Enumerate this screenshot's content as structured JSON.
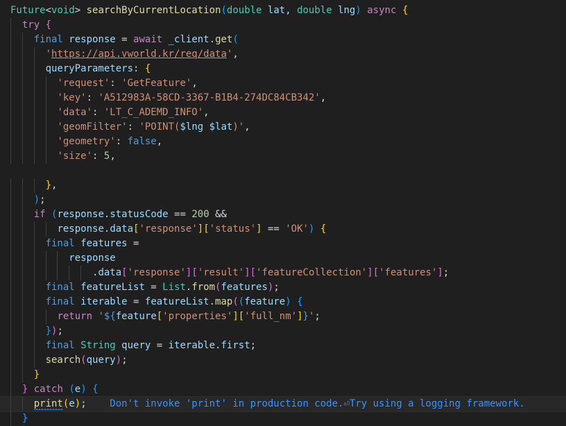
{
  "editor": {
    "lines": [
      {
        "indent": 0,
        "tokens": [
          [
            "Future",
            "type"
          ],
          [
            "<",
            "op"
          ],
          [
            "void",
            "type"
          ],
          [
            "> ",
            "op"
          ],
          [
            "searchByCurrentLocation",
            "fn"
          ],
          [
            "(",
            "p3"
          ],
          [
            "double",
            "type"
          ],
          [
            " lat, ",
            "var"
          ],
          [
            "double",
            "type"
          ],
          [
            " lng",
            "var"
          ],
          [
            ")",
            "p3"
          ],
          [
            " async ",
            "kw"
          ],
          [
            "{",
            "p1"
          ]
        ]
      },
      {
        "indent": 2,
        "tokens": [
          [
            "try ",
            "kw"
          ],
          [
            "{",
            "p2"
          ]
        ]
      },
      {
        "indent": 4,
        "tokens": [
          [
            "final ",
            "decl"
          ],
          [
            "response",
            "var"
          ],
          [
            " = ",
            "op"
          ],
          [
            "await ",
            "kw"
          ],
          [
            "_client",
            "var"
          ],
          [
            ".",
            "op"
          ],
          [
            "get",
            "fn"
          ],
          [
            "(",
            "p3"
          ]
        ]
      },
      {
        "indent": 6,
        "tokens": [
          [
            "'",
            "str"
          ],
          [
            "https://api.vworld.kr/req/data",
            "url"
          ],
          [
            "'",
            "str"
          ],
          [
            ",",
            "op"
          ]
        ]
      },
      {
        "indent": 6,
        "tokens": [
          [
            "queryParameters",
            "var"
          ],
          [
            ": ",
            "op"
          ],
          [
            "{",
            "p1"
          ]
        ]
      },
      {
        "indent": 8,
        "tokens": [
          [
            "'request'",
            "str"
          ],
          [
            ": ",
            "op"
          ],
          [
            "'GetFeature'",
            "str"
          ],
          [
            ",",
            "op"
          ]
        ]
      },
      {
        "indent": 8,
        "tokens": [
          [
            "'key'",
            "str"
          ],
          [
            ": ",
            "op"
          ],
          [
            "'A512983A-58CD-3367-B1B4-274DC84CB342'",
            "str"
          ],
          [
            ",",
            "op"
          ]
        ]
      },
      {
        "indent": 8,
        "tokens": [
          [
            "'data'",
            "str"
          ],
          [
            ": ",
            "op"
          ],
          [
            "'LT_C_ADEMD_INFO'",
            "str"
          ],
          [
            ",",
            "op"
          ]
        ]
      },
      {
        "indent": 8,
        "tokens": [
          [
            "'geomFilter'",
            "str"
          ],
          [
            ": ",
            "op"
          ],
          [
            "'POINT(",
            "str"
          ],
          [
            "$lng",
            "var"
          ],
          [
            " ",
            "str"
          ],
          [
            "$lat",
            "var"
          ],
          [
            ")'",
            "str"
          ],
          [
            ",",
            "op"
          ]
        ]
      },
      {
        "indent": 8,
        "tokens": [
          [
            "'geometry'",
            "str"
          ],
          [
            ": ",
            "op"
          ],
          [
            "false",
            "decl"
          ],
          [
            ",",
            "op"
          ]
        ]
      },
      {
        "indent": 8,
        "tokens": [
          [
            "'size'",
            "str"
          ],
          [
            ": ",
            "op"
          ],
          [
            "5",
            "num"
          ],
          [
            ",",
            "op"
          ]
        ]
      },
      {
        "indent": 0,
        "tokens": []
      },
      {
        "indent": 6,
        "tokens": [
          [
            "}",
            "p1"
          ],
          [
            ",",
            "op"
          ]
        ]
      },
      {
        "indent": 4,
        "tokens": [
          [
            ")",
            "p3"
          ],
          [
            ";",
            "op"
          ]
        ]
      },
      {
        "indent": 4,
        "tokens": [
          [
            "if ",
            "kw"
          ],
          [
            "(",
            "p3"
          ],
          [
            "response",
            "var"
          ],
          [
            ".",
            "op"
          ],
          [
            "statusCode",
            "var"
          ],
          [
            " == ",
            "op"
          ],
          [
            "200",
            "num"
          ],
          [
            " &&",
            "op"
          ]
        ]
      },
      {
        "indent": 8,
        "tokens": [
          [
            "response",
            "var"
          ],
          [
            ".",
            "op"
          ],
          [
            "data",
            "var"
          ],
          [
            "[",
            "p1"
          ],
          [
            "'response'",
            "str"
          ],
          [
            "]",
            "p1"
          ],
          [
            "[",
            "p1"
          ],
          [
            "'status'",
            "str"
          ],
          [
            "]",
            "p1"
          ],
          [
            " == ",
            "op"
          ],
          [
            "'OK'",
            "str"
          ],
          [
            ")",
            "p3"
          ],
          [
            " ",
            "op"
          ],
          [
            "{",
            "p1"
          ]
        ]
      },
      {
        "indent": 6,
        "tokens": [
          [
            "final ",
            "decl"
          ],
          [
            "features",
            "var"
          ],
          [
            " =",
            "op"
          ]
        ]
      },
      {
        "indent": 10,
        "tokens": [
          [
            "response",
            "var"
          ]
        ]
      },
      {
        "indent": 14,
        "tokens": [
          [
            ".",
            "op"
          ],
          [
            "data",
            "var"
          ],
          [
            "[",
            "p2"
          ],
          [
            "'response'",
            "str"
          ],
          [
            "]",
            "p2"
          ],
          [
            "[",
            "p2"
          ],
          [
            "'result'",
            "str"
          ],
          [
            "]",
            "p2"
          ],
          [
            "[",
            "p2"
          ],
          [
            "'featureCollection'",
            "str"
          ],
          [
            "]",
            "p2"
          ],
          [
            "[",
            "p2"
          ],
          [
            "'features'",
            "str"
          ],
          [
            "]",
            "p2"
          ],
          [
            ";",
            "op"
          ]
        ]
      },
      {
        "indent": 6,
        "tokens": [
          [
            "final ",
            "decl"
          ],
          [
            "featureList",
            "var"
          ],
          [
            " = ",
            "op"
          ],
          [
            "List",
            "type"
          ],
          [
            ".",
            "op"
          ],
          [
            "from",
            "fn"
          ],
          [
            "(",
            "p2"
          ],
          [
            "features",
            "var"
          ],
          [
            ")",
            "p2"
          ],
          [
            ";",
            "op"
          ]
        ]
      },
      {
        "indent": 6,
        "tokens": [
          [
            "final ",
            "decl"
          ],
          [
            "iterable",
            "var"
          ],
          [
            " = ",
            "op"
          ],
          [
            "featureList",
            "var"
          ],
          [
            ".",
            "op"
          ],
          [
            "map",
            "fn"
          ],
          [
            "(",
            "p2"
          ],
          [
            "(",
            "p3"
          ],
          [
            "feature",
            "var"
          ],
          [
            ")",
            "p3"
          ],
          [
            " ",
            "op"
          ],
          [
            "{",
            "p3"
          ]
        ]
      },
      {
        "indent": 8,
        "tokens": [
          [
            "return ",
            "kw"
          ],
          [
            "'",
            "str"
          ],
          [
            "${",
            "decl"
          ],
          [
            "feature",
            "var"
          ],
          [
            "[",
            "p1"
          ],
          [
            "'properties'",
            "str"
          ],
          [
            "]",
            "p1"
          ],
          [
            "[",
            "p1"
          ],
          [
            "'full_nm'",
            "str"
          ],
          [
            "]",
            "p1"
          ],
          [
            "}",
            "decl"
          ],
          [
            "'",
            "str"
          ],
          [
            ";",
            "op"
          ]
        ]
      },
      {
        "indent": 6,
        "tokens": [
          [
            "}",
            "p3"
          ],
          [
            ")",
            "p2"
          ],
          [
            ";",
            "op"
          ]
        ]
      },
      {
        "indent": 6,
        "tokens": [
          [
            "final ",
            "decl"
          ],
          [
            "String",
            "type"
          ],
          [
            " query",
            "var"
          ],
          [
            " = ",
            "op"
          ],
          [
            "iterable",
            "var"
          ],
          [
            ".",
            "op"
          ],
          [
            "first",
            "var"
          ],
          [
            ";",
            "op"
          ]
        ]
      },
      {
        "indent": 6,
        "tokens": [
          [
            "search",
            "fn"
          ],
          [
            "(",
            "p2"
          ],
          [
            "query",
            "var"
          ],
          [
            ")",
            "p2"
          ],
          [
            ";",
            "op"
          ]
        ]
      },
      {
        "indent": 4,
        "tokens": [
          [
            "}",
            "p1"
          ]
        ]
      },
      {
        "indent": 2,
        "tokens": [
          [
            "}",
            "p2"
          ],
          [
            " catch ",
            "kw"
          ],
          [
            "(",
            "p3"
          ],
          [
            "e",
            "var"
          ],
          [
            ")",
            "p3"
          ],
          [
            " ",
            "op"
          ],
          [
            "{",
            "p3"
          ]
        ]
      },
      {
        "indent": 4,
        "current": true,
        "tokens": [
          [
            "print",
            "fn"
          ],
          [
            "(",
            "p1"
          ],
          [
            "e",
            "var"
          ],
          [
            ")",
            "p1"
          ],
          [
            ";",
            "op"
          ]
        ],
        "diagnostic": "Don't invoke 'print' in production code.⏎Try using a logging framework."
      },
      {
        "indent": 2,
        "tokens": [
          [
            "}",
            "p3"
          ]
        ]
      },
      {
        "indent": 0,
        "tokens": [
          [
            "}",
            "p1"
          ]
        ]
      }
    ],
    "colors": {
      "background": "#1f1f1f",
      "type": "#4ec9b0",
      "function": "#dcdcaa",
      "keyword": "#c586c0",
      "declaration": "#569cd6",
      "variable": "#9cdcfe",
      "string": "#ce9178",
      "number": "#b5cea8",
      "info_squiggle": "#3794ff"
    }
  }
}
